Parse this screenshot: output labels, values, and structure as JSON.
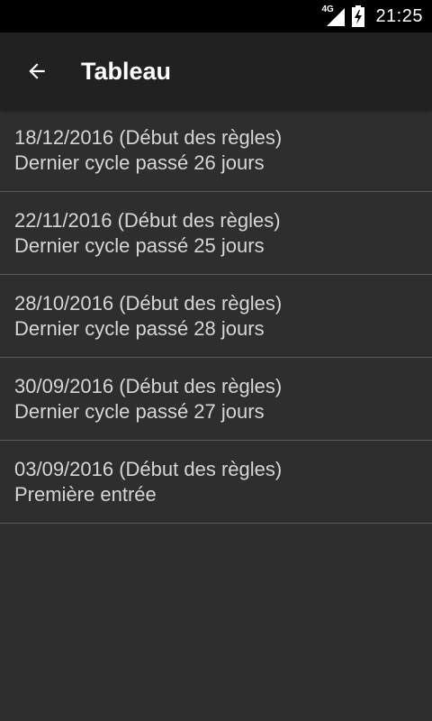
{
  "status_bar": {
    "network_label": "4G",
    "time": "21:25"
  },
  "app_bar": {
    "title": "Tableau",
    "back_icon": "arrow-left-icon"
  },
  "entries": [
    {
      "line1": "18/12/2016 (Début des règles)",
      "line2": "Dernier cycle passé 26 jours"
    },
    {
      "line1": "22/11/2016 (Début des règles)",
      "line2": "Dernier cycle passé 25 jours"
    },
    {
      "line1": "28/10/2016 (Début des règles)",
      "line2": "Dernier cycle passé 28 jours"
    },
    {
      "line1": "30/09/2016 (Début des règles)",
      "line2": "Dernier cycle passé 27 jours"
    },
    {
      "line1": "03/09/2016 (Début des règles)",
      "line2": "Première entrée"
    }
  ],
  "colors": {
    "status_bar_bg": "#000000",
    "app_bar_bg": "#212121",
    "list_bg": "#2e2e2e",
    "text": "#d6d6d6",
    "divider": "#5a5a5a"
  }
}
